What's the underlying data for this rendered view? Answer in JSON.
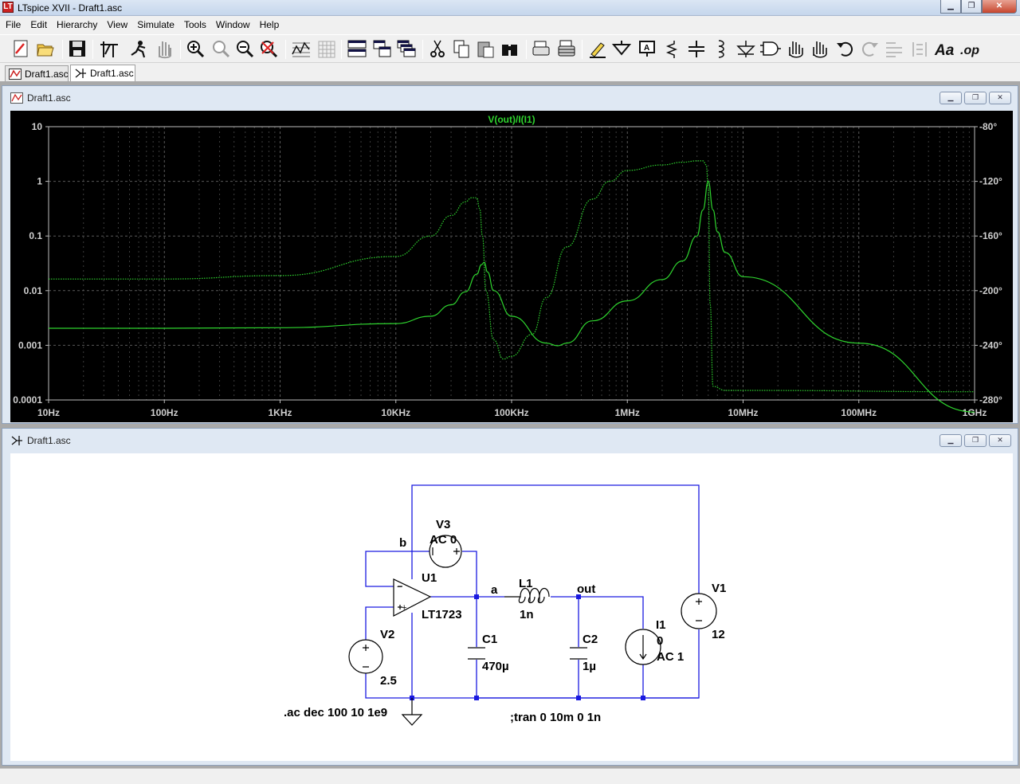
{
  "window": {
    "title": "LTspice XVII - Draft1.asc",
    "app_icon": "LT"
  },
  "menu": [
    "File",
    "Edit",
    "Hierarchy",
    "View",
    "Simulate",
    "Tools",
    "Window",
    "Help"
  ],
  "tabs": [
    {
      "label": "Draft1.asc",
      "icon": "waveform-icon",
      "active": false
    },
    {
      "label": "Draft1.asc",
      "icon": "schematic-icon",
      "active": true
    }
  ],
  "plot_window": {
    "title": "Draft1.asc"
  },
  "schematic_window": {
    "title": "Draft1.asc"
  },
  "colors": {
    "trace": "#2ed42e",
    "grid": "#5a5a5a",
    "wire": "#1a1ae0",
    "node": "#1a1ae0"
  },
  "chart_data": {
    "type": "line",
    "title": "V(out)/I(I1)",
    "x_scale": "log",
    "xlim": [
      10,
      1000000000
    ],
    "x_ticks": [
      "10Hz",
      "100Hz",
      "1KHz",
      "10KHz",
      "100KHz",
      "1MHz",
      "10MHz",
      "100MHz",
      "1GHz"
    ],
    "y_scale": "log",
    "ylim": [
      0.0001,
      10
    ],
    "y_ticks": [
      "10",
      "1",
      "0.1",
      "0.01",
      "0.001",
      "0.0001"
    ],
    "y2lim": [
      -280,
      -80
    ],
    "y2_ticks": [
      "-80°",
      "-120°",
      "-160°",
      "-200°",
      "-240°",
      "-280°"
    ],
    "grid": true,
    "series": [
      {
        "kind": "magnitude",
        "style": "solid",
        "x": [
          10,
          100,
          1000,
          10000,
          20000,
          30000,
          40000,
          50000,
          55000,
          58000,
          62000,
          70000,
          100000,
          200000,
          250000,
          300000,
          500000,
          1000000,
          2000000,
          3000000,
          4000000,
          4500000,
          5000000,
          5500000,
          6000000,
          7000000,
          10000000,
          100000000,
          1000000000
        ],
        "y": [
          0.00205,
          0.00205,
          0.0021,
          0.0025,
          0.0034,
          0.0055,
          0.0095,
          0.02,
          0.03,
          0.033,
          0.022,
          0.01,
          0.0034,
          0.0011,
          0.00098,
          0.0011,
          0.0028,
          0.0065,
          0.016,
          0.035,
          0.1,
          0.3,
          1.0,
          0.3,
          0.12,
          0.05,
          0.018,
          0.0011,
          6e-05
        ]
      },
      {
        "kind": "phase",
        "style": "dotted",
        "x": [
          10,
          100,
          1000,
          10000,
          20000,
          30000,
          40000,
          45000,
          50000,
          53000,
          56000,
          60000,
          70000,
          85000,
          100000,
          150000,
          200000,
          300000,
          500000,
          700000,
          1000000,
          2000000,
          3000000,
          4000000,
          4500000,
          4800000,
          5000000,
          5200000,
          5500000,
          7000000,
          10000000,
          1000000000
        ],
        "y": [
          -191.5,
          -191.5,
          -189,
          -175,
          -160,
          -145,
          -135,
          -132,
          -132,
          -140,
          -160,
          -200,
          -236,
          -250,
          -248,
          -232,
          -205,
          -168,
          -133,
          -120,
          -112,
          -108,
          -106,
          -105,
          -105,
          -108,
          -125,
          -210,
          -270,
          -273,
          -273,
          -274
        ]
      }
    ]
  },
  "schematic": {
    "components": [
      {
        "ref": "V3",
        "value": "AC 0"
      },
      {
        "ref": "U1",
        "value": "LT1723"
      },
      {
        "ref": "L1",
        "value": "1n"
      },
      {
        "ref": "C1",
        "value": "470µ"
      },
      {
        "ref": "C2",
        "value": "1µ"
      },
      {
        "ref": "I1",
        "value": "0",
        "value2": "AC 1"
      },
      {
        "ref": "V1",
        "value": "12"
      },
      {
        "ref": "V2",
        "value": "2.5"
      }
    ],
    "nets": {
      "b": "b",
      "a": "a",
      "out": "out"
    },
    "directives": {
      "ac": ".ac dec 100 10 1e9",
      "tran": ";tran 0 10m 0 1n"
    },
    "opamp_pins": {
      "minus": "−",
      "plus": "+"
    }
  }
}
